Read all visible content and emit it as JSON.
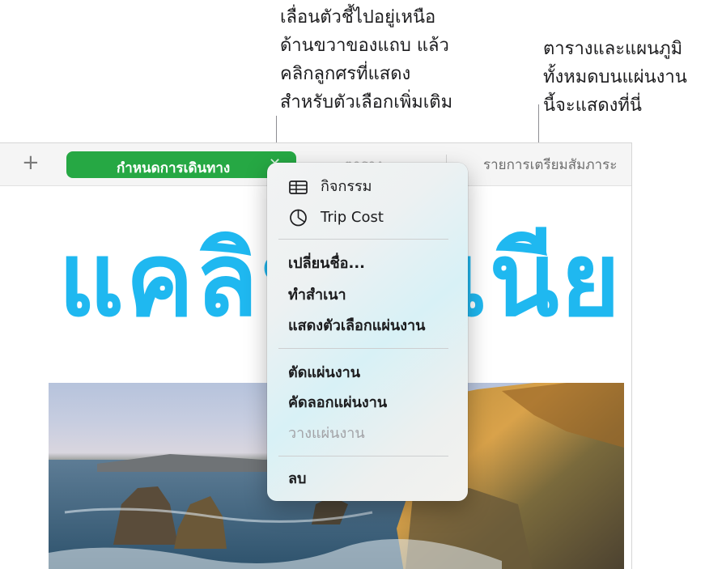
{
  "callouts": {
    "left": [
      "เลื่อนตัวชี้ไปอยู่เหนือ",
      "ด้านขวาของแถบ แล้ว",
      "คลิกลูกศรที่แสดง",
      "สำหรับตัวเลือกเพิ่มเติม"
    ],
    "right": [
      "ตารางและแผนภูมิ",
      "ทั้งหมดบนแผ่นงาน",
      "นี้จะแสดงที่นี่"
    ]
  },
  "tabbar": {
    "add_label": "+",
    "active_tab": "กำหนดการเดินทาง",
    "close_glyph": "✕",
    "tabs": [
      "ตาราง",
      "รายการเตรียมสัมภาระ"
    ]
  },
  "sheet": {
    "title": "แคลิฟอร์เนีย"
  },
  "menu": {
    "objects": [
      {
        "label": "กิจกรรม",
        "icon": "table-icon"
      },
      {
        "label": "Trip Cost",
        "icon": "pie-chart-icon"
      }
    ],
    "group2": [
      "เปลี่ยนชื่อ...",
      "ทำสำเนา",
      "แสดงตัวเลือกแผ่นงาน"
    ],
    "group3": [
      "ตัดแผ่นงาน",
      "คัดลอกแผ่นงาน",
      "วางแผ่นงาน"
    ],
    "group4": [
      "ลบ"
    ]
  },
  "colors": {
    "tab_active": "#26a844",
    "title": "#1fb8f0",
    "menu_text": "#1c1c1e",
    "menu_disabled": "#a2a2a6"
  }
}
